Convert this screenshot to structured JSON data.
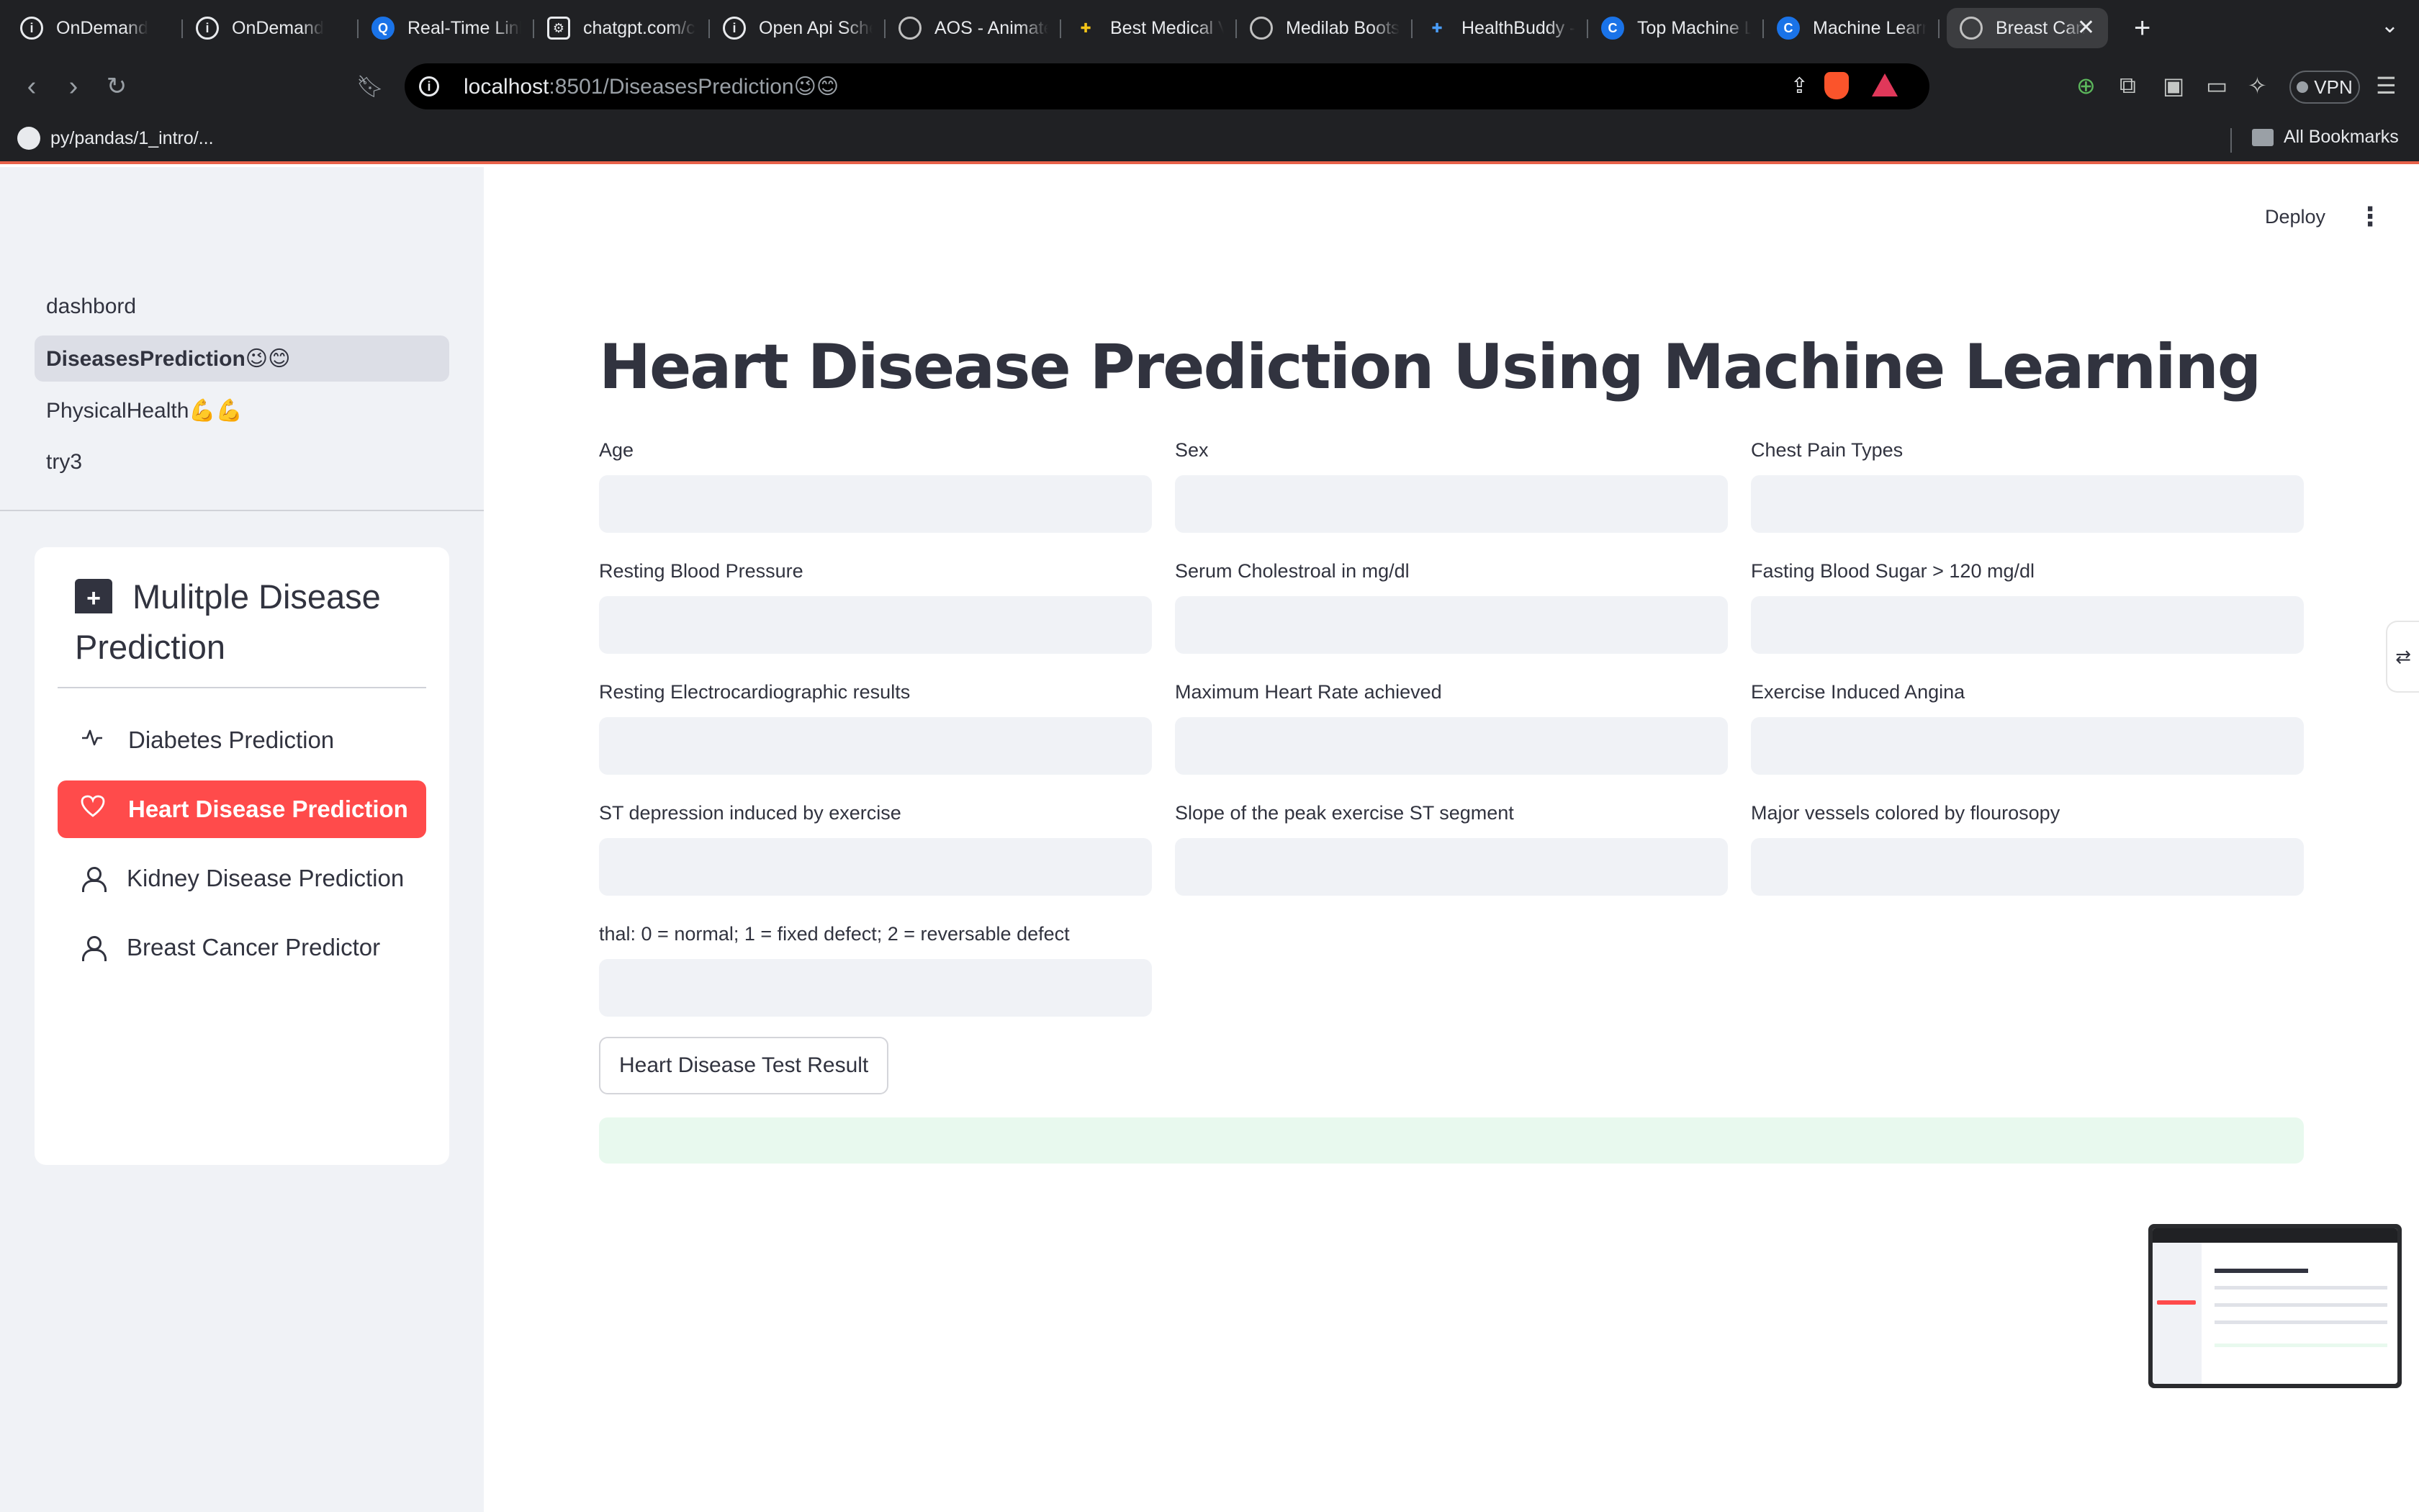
{
  "browser": {
    "tabs": [
      {
        "label": "OnDemand",
        "icon": "info-circle-icon"
      },
      {
        "label": "OnDemand",
        "icon": "info-circle-icon"
      },
      {
        "label": "Real-Time Link",
        "icon": "q-logo-icon"
      },
      {
        "label": "chatgpt.com/c",
        "icon": "openai-icon"
      },
      {
        "label": "Open Api Sche",
        "icon": "info-circle-icon"
      },
      {
        "label": "AOS - Animate",
        "icon": "globe-icon"
      },
      {
        "label": "Best Medical V",
        "icon": "medical-icon"
      },
      {
        "label": "Medilab Boots",
        "icon": "globe-icon"
      },
      {
        "label": "HealthBuddy -",
        "icon": "health-icon"
      },
      {
        "label": "Top Machine L",
        "icon": "c-logo-icon"
      },
      {
        "label": "Machine Learn",
        "icon": "c-logo-icon"
      }
    ],
    "active_tab": {
      "label": "Breast Can",
      "icon": "globe-icon"
    },
    "url_host": "localhost",
    "url_rest": ":8501/DiseasesPrediction😉😊",
    "vpn_label": "VPN",
    "brave_badge": "1",
    "bookmark_1": "py/pandas/1_intro/...",
    "all_bookmarks": "All Bookmarks"
  },
  "sidebar": {
    "pages": [
      {
        "label": "dashbord",
        "active": false
      },
      {
        "label": "DiseasesPrediction😉😊",
        "active": true
      },
      {
        "label": "PhysicalHealth💪💪",
        "active": false
      },
      {
        "label": "try3",
        "active": false
      }
    ],
    "menu_title_line1": "Mulitple Disease",
    "menu_title_line2": "Prediction",
    "menu_items": [
      {
        "label": "Diabetes Prediction",
        "icon": "activity-icon",
        "active": false
      },
      {
        "label": "Heart Disease Prediction",
        "icon": "heart-icon",
        "active": true
      },
      {
        "label": "Kidney Disease Prediction",
        "icon": "person-icon",
        "active": false
      },
      {
        "label": "Breast Cancer Predictor",
        "icon": "person-icon",
        "active": false
      }
    ]
  },
  "header": {
    "deploy_label": "Deploy",
    "menu_glyph": "⋮"
  },
  "main": {
    "title": "Heart Disease Prediction Using Machine Learning",
    "fields": [
      {
        "label": "Age",
        "value": ""
      },
      {
        "label": "Sex",
        "value": ""
      },
      {
        "label": "Chest Pain Types",
        "value": ""
      },
      {
        "label": "Resting Blood Pressure",
        "value": ""
      },
      {
        "label": "Serum Cholestroal in mg/dl",
        "value": ""
      },
      {
        "label": "Fasting Blood Sugar > 120 mg/dl",
        "value": ""
      },
      {
        "label": "Resting Electrocardiographic results",
        "value": ""
      },
      {
        "label": "Maximum Heart Rate achieved",
        "value": ""
      },
      {
        "label": "Exercise Induced Angina",
        "value": ""
      },
      {
        "label": "ST depression induced by exercise",
        "value": ""
      },
      {
        "label": "Slope of the peak exercise ST segment",
        "value": ""
      },
      {
        "label": "Major vessels colored by flourosopy",
        "value": ""
      },
      {
        "label": "thal: 0 = normal; 1 = fixed defect; 2 = reversable defect",
        "value": ""
      }
    ],
    "button_label": "Heart Disease Test Result",
    "result_text": ""
  },
  "colors": {
    "accent": "#ff4b4b",
    "sidebar_bg": "#f0f2f6",
    "input_bg": "#f0f2f6",
    "text": "#31333f",
    "success_bg": "#e8f9ee"
  }
}
